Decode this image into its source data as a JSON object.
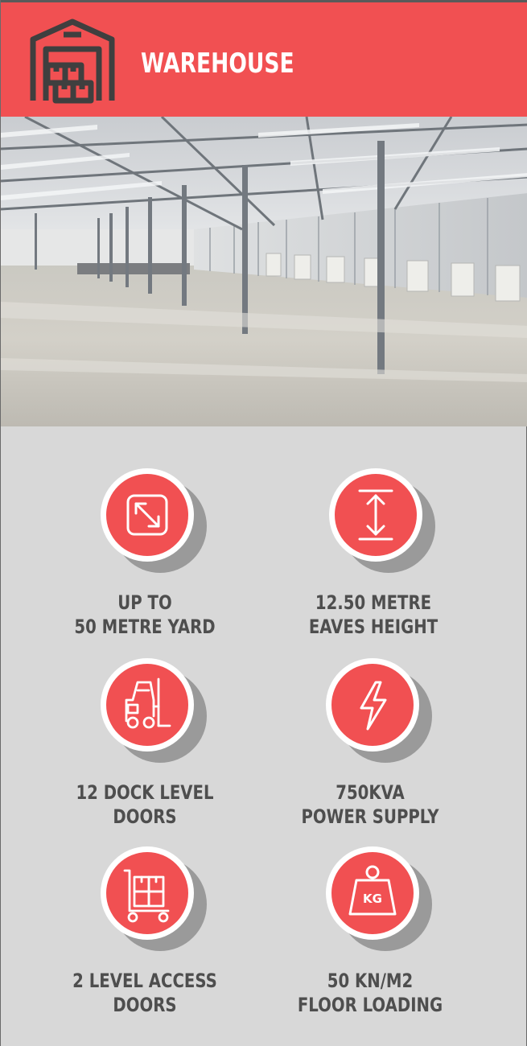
{
  "header": {
    "title": "WAREHOUSE",
    "icon": "warehouse-icon",
    "colors": {
      "background": "#f15052",
      "icon_stroke": "#3f3f3f",
      "text": "#ffffff"
    }
  },
  "photo": {
    "subject": "warehouse-interior-photo"
  },
  "features": [
    {
      "icon": "resize-arrows-icon",
      "line1": "UP TO",
      "line2": "50 METRE YARD"
    },
    {
      "icon": "vertical-height-icon",
      "line1": "12.50 METRE",
      "line2": "EAVES HEIGHT"
    },
    {
      "icon": "forklift-icon",
      "line1": "12 DOCK LEVEL",
      "line2": "DOORS"
    },
    {
      "icon": "lightning-bolt-icon",
      "line1": "750KVA",
      "line2": "POWER SUPPLY"
    },
    {
      "icon": "hand-trolley-boxes-icon",
      "line1": "2 LEVEL ACCESS",
      "line2": "DOORS"
    },
    {
      "icon": "kg-weight-icon",
      "line1": "50 KN/M2",
      "line2": "FLOOR LOADING"
    }
  ],
  "colors": {
    "accent": "#f15052",
    "panel": "#d8d8d8",
    "label": "#4e4e4e",
    "shadow": "#9a9a9a"
  }
}
